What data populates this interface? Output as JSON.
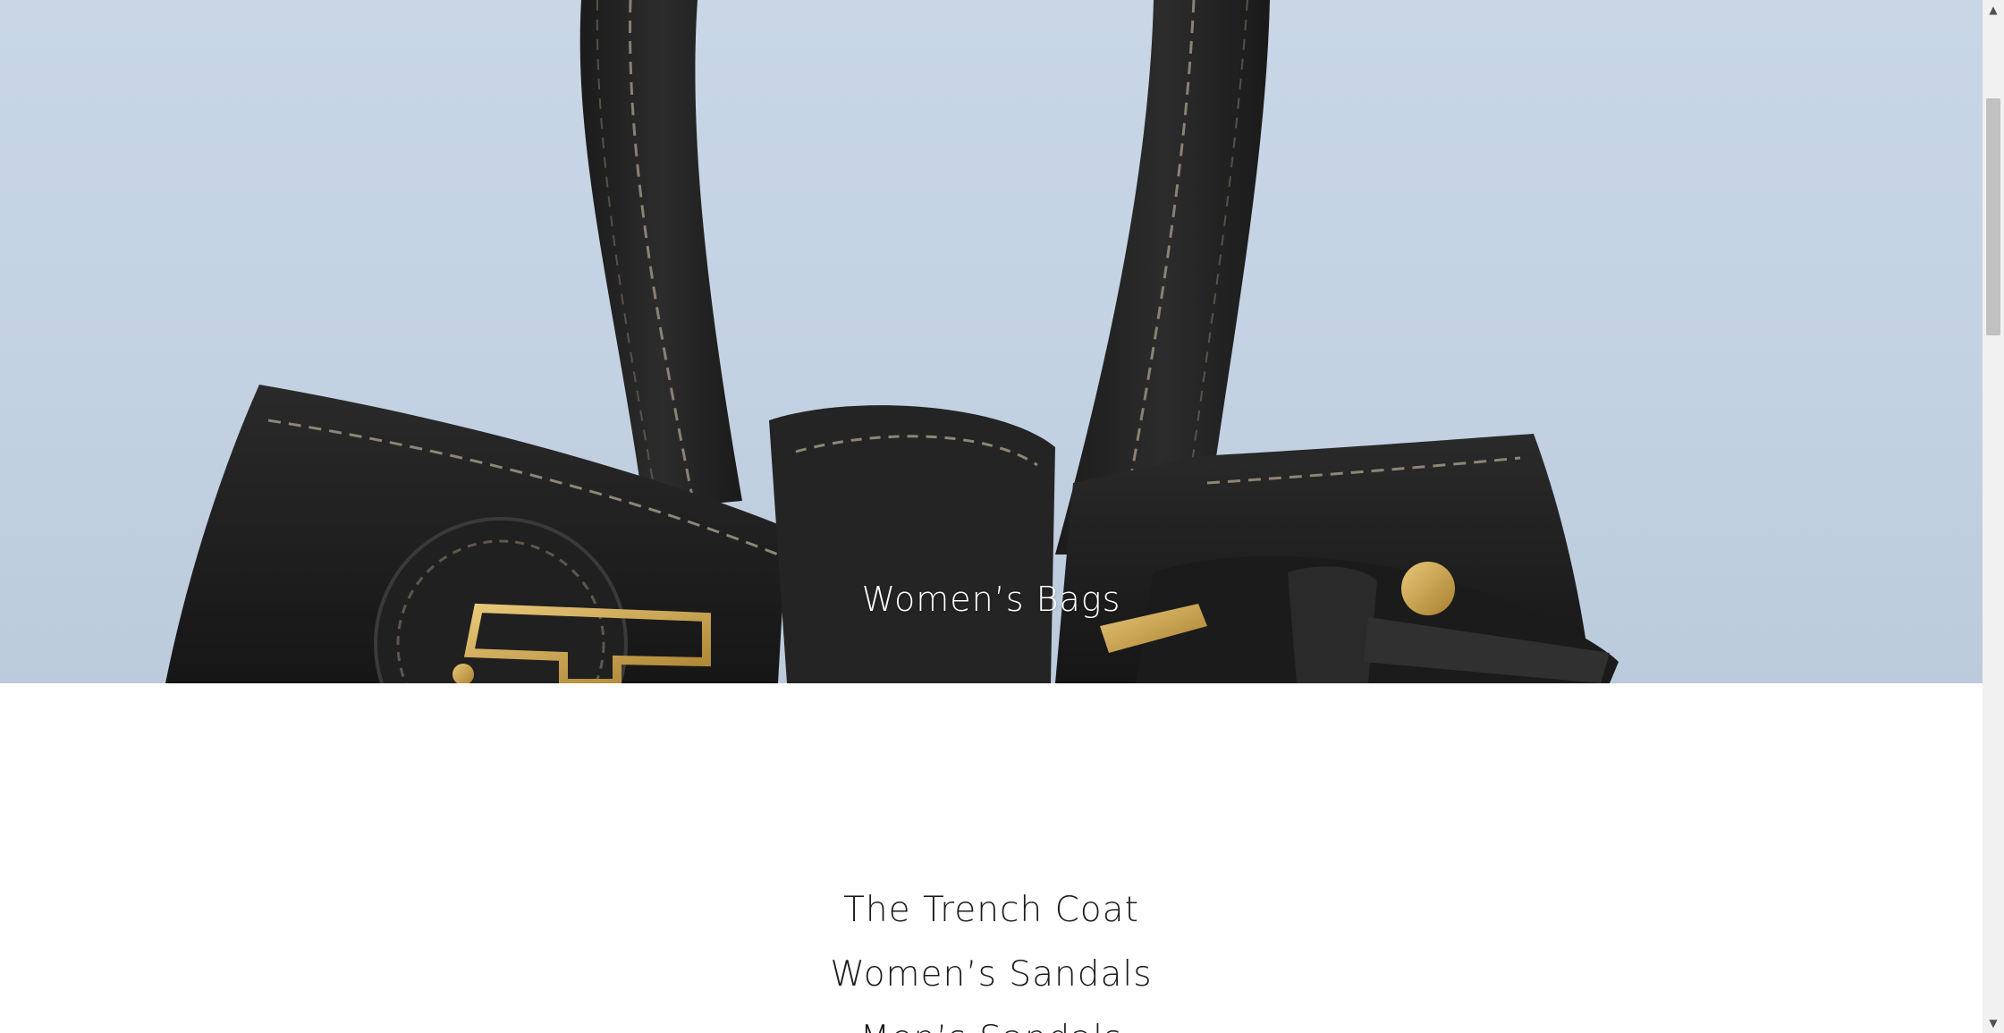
{
  "hero": {
    "title": "Women’s Bags",
    "image": "black-leather-bag-photo"
  },
  "menu": {
    "items": [
      {
        "label": "The Trench Coat"
      },
      {
        "label": "Women’s Sandals"
      },
      {
        "label": "Men’s Sandals"
      }
    ]
  },
  "scrollbar": {
    "up_icon": "▲",
    "down_icon": "▼"
  },
  "colors": {
    "hero_background": "#c8d6e6",
    "bag_leather": "#1f1f1f",
    "hardware_gold": "#c9a24a",
    "text_dark": "#1c1c1c"
  }
}
